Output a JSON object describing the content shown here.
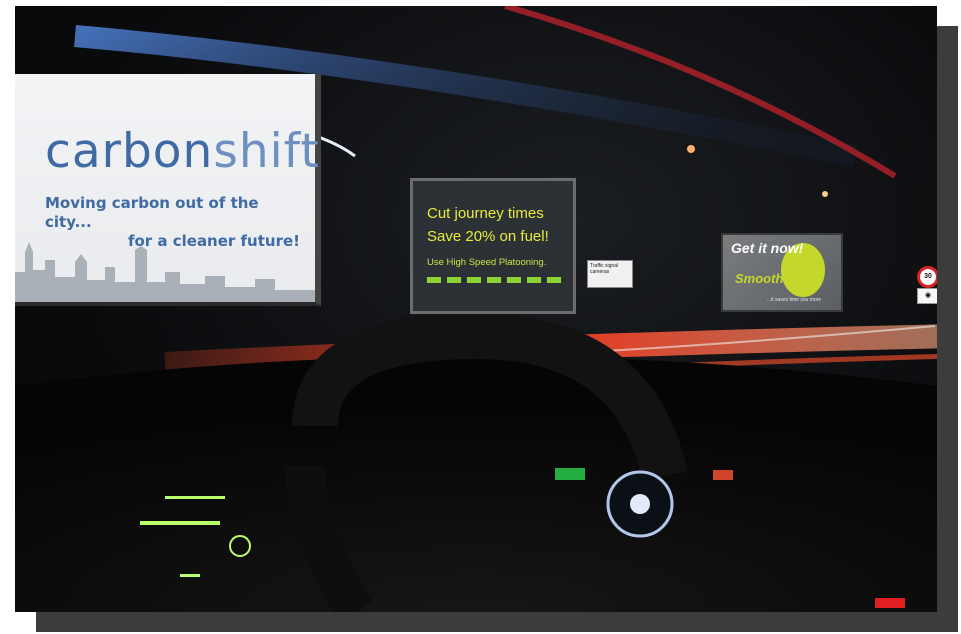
{
  "billboard_1": {
    "brand_part1": "carbon",
    "brand_part2": "shift",
    "tagline_line1": "Moving carbon out of the city...",
    "tagline_line2": "for a cleaner future!"
  },
  "billboard_2": {
    "headline_line1": "Cut journey times",
    "headline_line2": "Save 20% on fuel!",
    "subline": "Use High Speed Platooning."
  },
  "billboard_3": {
    "headline": "Get it now!",
    "brand": "Smoothflow",
    "fine_print": "...it saves time you more"
  },
  "roadside_sign": {
    "text": "Traffic signal cameras"
  },
  "speed_limit": {
    "value": "30"
  },
  "icons": {
    "camera_sign": "camera-icon"
  },
  "colors": {
    "carbonshift_blue": "#3f6aa3",
    "platooning_yellow": "#e9ec3b",
    "smoothflow_green": "#c4d82c",
    "light_trail_red": "#d8262c"
  }
}
